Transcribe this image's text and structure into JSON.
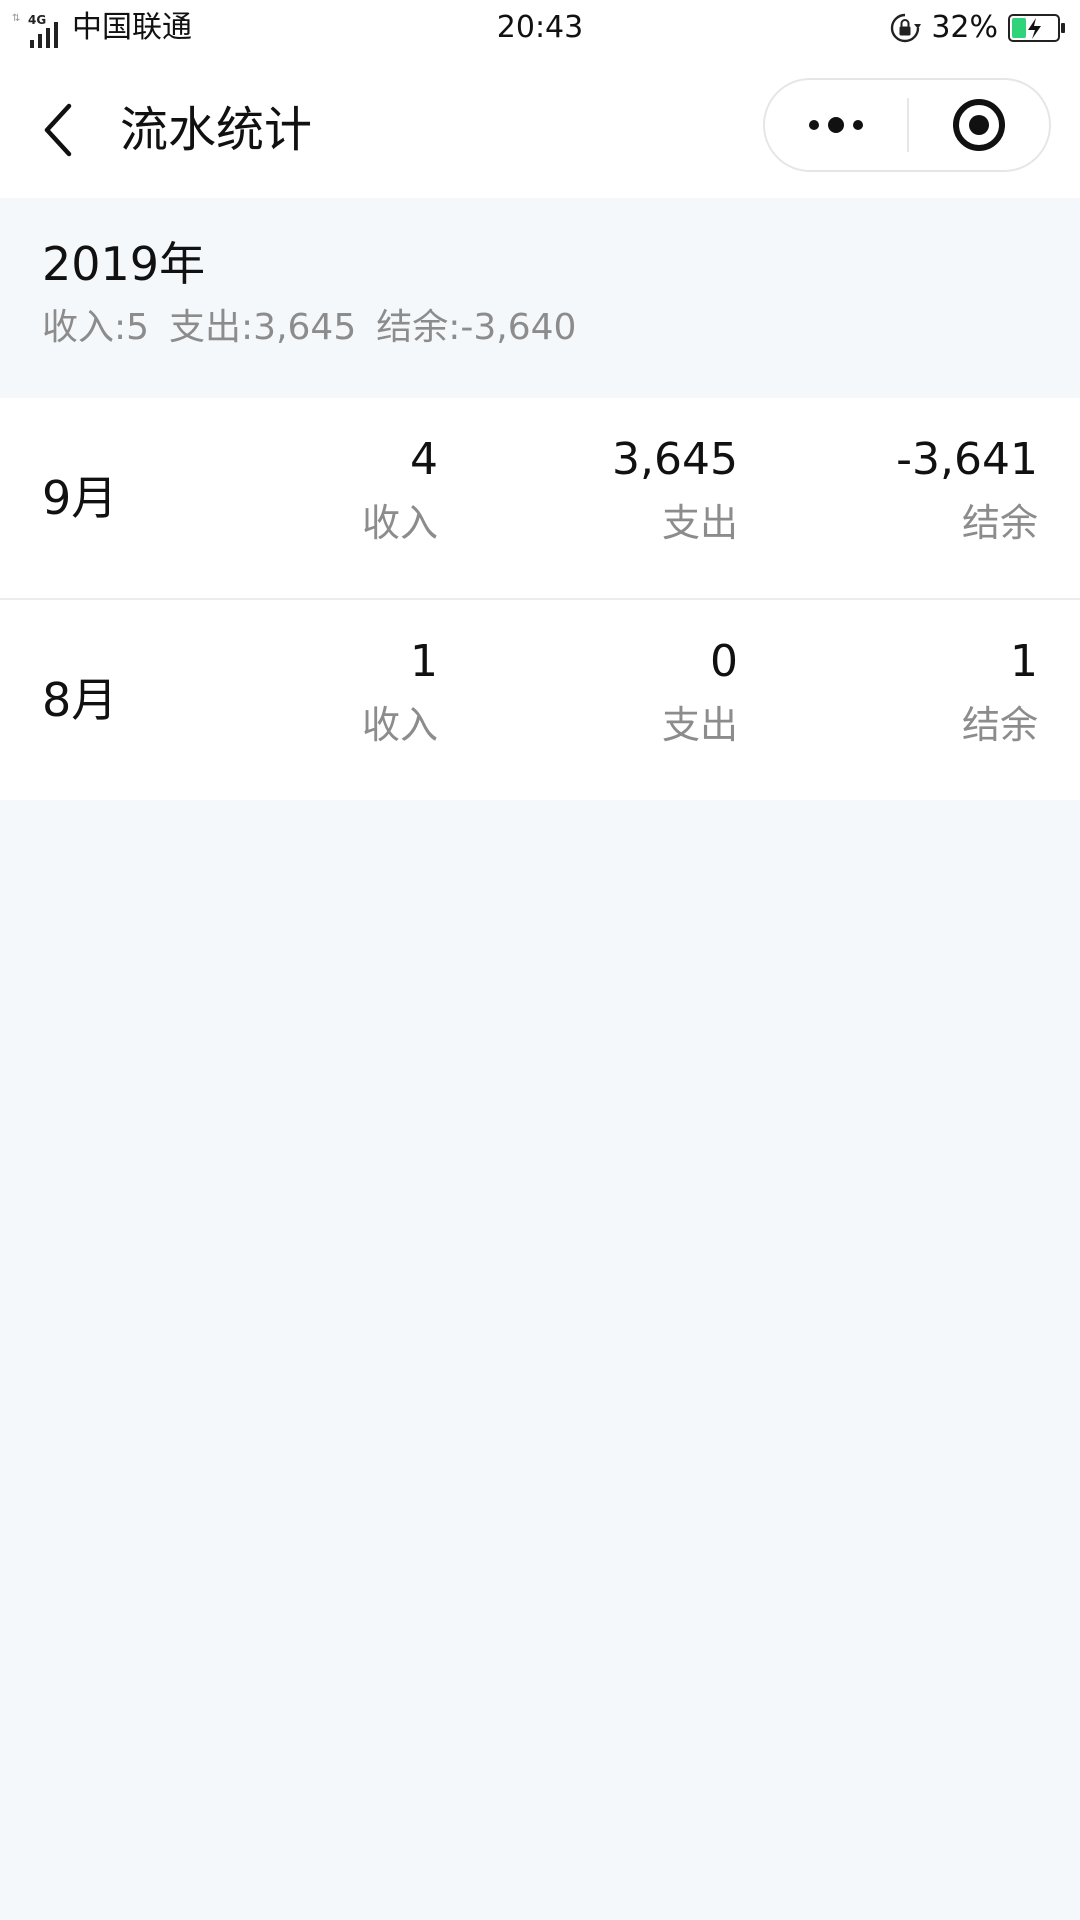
{
  "status_bar": {
    "network": "4G",
    "carrier": "中国联通",
    "time": "20:43",
    "battery_percent": "32%",
    "battery_level": 0.32,
    "battery_color": "#2fd47a",
    "icons": [
      "signal-icon",
      "rotation-lock-icon",
      "battery-charging-icon"
    ]
  },
  "nav": {
    "title": "流水统计",
    "back_icon": "chevron-left-icon",
    "more_icon": "more-dots-icon",
    "close_icon": "target-close-icon"
  },
  "summary": {
    "year": "2019年",
    "income": "收入:5",
    "expense": "支出:3,645",
    "balance": "结余:-3,640"
  },
  "months": [
    {
      "month": "9月",
      "income": "4",
      "income_label": "收入",
      "expense": "3,645",
      "expense_label": "支出",
      "balance": "-3,641",
      "balance_label": "结余"
    },
    {
      "month": "8月",
      "income": "1",
      "income_label": "收入",
      "expense": "0",
      "expense_label": "支出",
      "balance": "1",
      "balance_label": "结余"
    }
  ],
  "colors": {
    "page_background": "#f5f8fb",
    "card_background": "#ffffff",
    "primary_text": "#111111",
    "secondary_text": "#8c8c8c"
  }
}
